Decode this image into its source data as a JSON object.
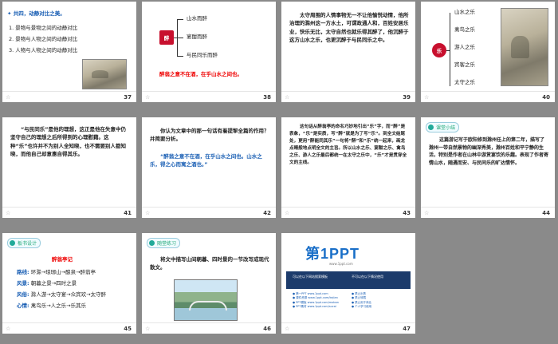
{
  "slides": [
    {
      "number": "37",
      "title": "共四，动静对比之美。",
      "lines": [
        "1. 景物与景物之间的动静对比",
        "2. 景物与人物之间的动静对比",
        "3. 人物与人物之间的动静对比"
      ]
    },
    {
      "number": "38",
      "center": "醉",
      "branches": [
        "山水而醉",
        "宴酣而醉",
        "与民同乐而醉"
      ],
      "footer_red": "醉翁之意不在酒，在乎山水之间也。"
    },
    {
      "number": "39",
      "paragraph": "太守周围的人情事物无一不让他愉悦动情，他所治理的滁州这一方水土，可谓政通人和，百姓安居乐业，快乐无比，太守自然也就乐得其醉了，他沉醉于这方山水之乐，也更沉醉于与民同乐之中。"
    },
    {
      "number": "40",
      "center": "乐",
      "branches": [
        "山水之乐",
        "禽鸟之乐",
        "游人之乐",
        "宾客之乐",
        "太守之乐"
      ]
    },
    {
      "number": "41",
      "paragraph": "“与民同乐”是他的理想，这正是他在失意中仍坚守自己的理想之后所得到的心理慰藉。这种“乐”也许并不为别人全知晓，也不需要别人都知晓，而他自己却意惠自得其乐。"
    },
    {
      "number": "42",
      "question": "你认为文章中的那一句话有着提挈全篇的作用？并简要分析。",
      "answer": "“醉翁之意不在酒，在乎山水之间也。山水之乐，得之心而寓之酒也。”"
    },
    {
      "number": "43",
      "paragraph": "这句话从醉翁亭的命名巧妙地引出“乐”字，而“醉”是表象，“乐”是实质，写“醉”就是为了写“乐”。到全文结尾处，更用“醉能同其乐”一句将“醉”和“乐”统一起来，画龙点睛般地点明全文的主旨。所以山水之乐、宴酣之乐、禽鸟之乐、游人之乐最后都统一在太守之乐中，“乐”才是贯穿全文的主线。"
    },
    {
      "number": "44",
      "tag": "课堂小结",
      "paragraph": "这篇游记写于欧阳修到滁州任上的第二年，描写了滁州一带自然景物的幽深秀美，滁州百姓和平宁静的生活，特别是作者在山林中游赏宴饮的乐趣。表现了作者寄情山水，随遇而安、与民同乐的旷达情怀。"
    },
    {
      "number": "45",
      "tag": "板书设计",
      "title": "醉翁亭记",
      "rows": [
        {
          "label": "路线:",
          "text": "环滁→琅琊山→酿泉→醉翁亭"
        },
        {
          "label": "风景:",
          "text": "朝暮之景→四时之景"
        },
        {
          "label": "风俗:",
          "text": "滁人游→太守宴→众宾欢→太守醉"
        },
        {
          "label": "心情:",
          "text": "禽鸟乐→人之乐→乐其乐"
        }
      ]
    },
    {
      "number": "46",
      "tag": "随堂练习",
      "paragraph": "将文中描写山间朝暮、四时景的一节改写成现代散文。"
    },
    {
      "number": "47",
      "logo_main": "第1PPT",
      "logo_sub": "www.1ppt.com",
      "band_left": "可以在以下网站搜索模板",
      "band_right": "不可以在以下情况使用",
      "list_left": [
        "● 第一PPT  www.1ppt.com",
        "● 课件资源 www.1ppt.com/kejian",
        "● PPT模板 www.1ppt.com/moban",
        "● PPT素材 www.1ppt.com/sucai"
      ],
      "list_right": [
        "● 禁止出售",
        "● 禁止转载",
        "● 禁止用于商业",
        "● 个人学习使用"
      ]
    }
  ]
}
